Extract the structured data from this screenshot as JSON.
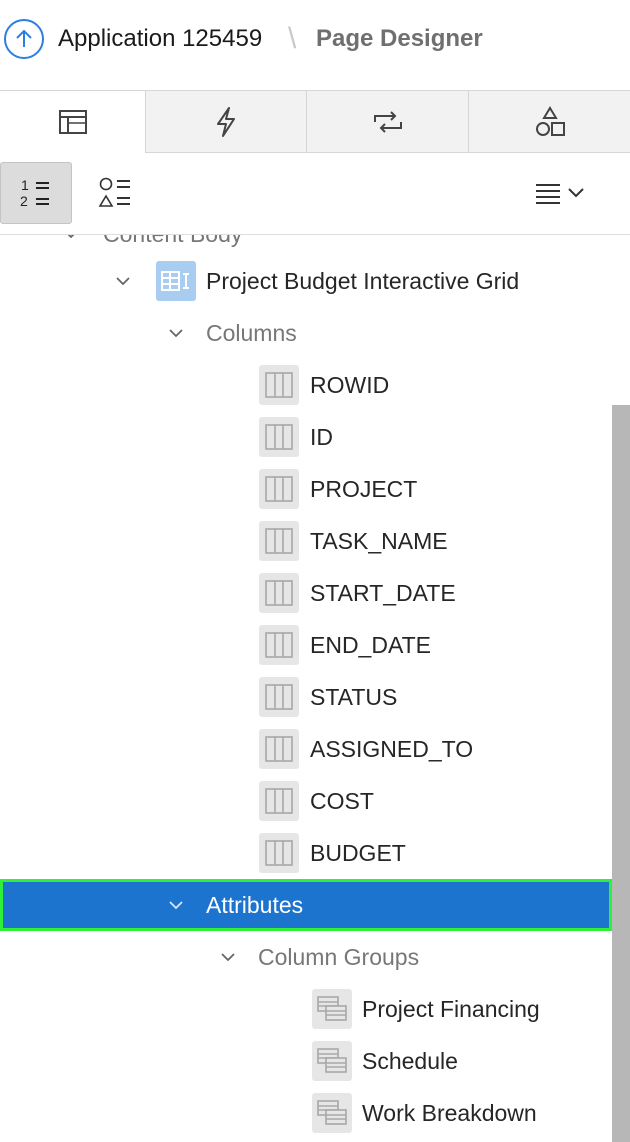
{
  "header": {
    "application": "Application 125459",
    "separator": "\\",
    "page": "Page Designer"
  },
  "tabs": [
    {
      "icon": "rendering-icon",
      "active": true
    },
    {
      "icon": "lightning-icon",
      "active": false
    },
    {
      "icon": "processing-icon",
      "active": false
    },
    {
      "icon": "shared-components-icon",
      "active": false
    }
  ],
  "toolbar": {
    "order_label_1": "1",
    "order_label_2": "2",
    "menu_icon": "list-menu-icon"
  },
  "tree": {
    "cut_node": "Content Body",
    "region": "Project Budget Interactive Grid",
    "columns_folder": "Columns",
    "columns": [
      "ROWID",
      "ID",
      "PROJECT",
      "TASK_NAME",
      "START_DATE",
      "END_DATE",
      "STATUS",
      "ASSIGNED_TO",
      "COST",
      "BUDGET"
    ],
    "attributes": "Attributes",
    "column_groups_folder": "Column Groups",
    "column_groups": [
      "Project Financing",
      "Schedule",
      "Work Breakdown"
    ]
  },
  "colors": {
    "selection": "#1c74cf",
    "highlight_outline": "#2ef03a",
    "accent": "#2b7fe0"
  }
}
